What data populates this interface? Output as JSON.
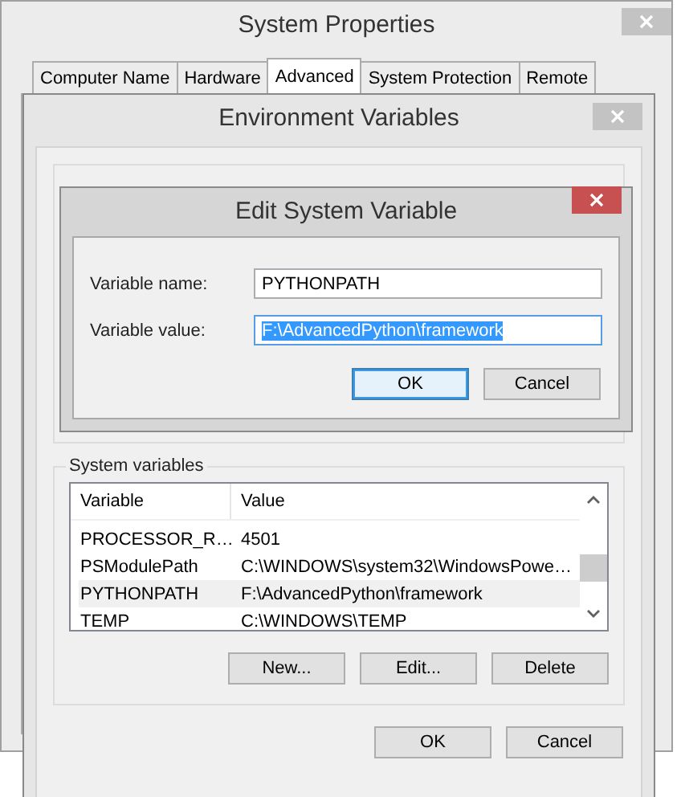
{
  "system_properties": {
    "title": "System Properties",
    "tabs": [
      {
        "label": "Computer Name",
        "selected": false
      },
      {
        "label": "Hardware",
        "selected": false
      },
      {
        "label": "Advanced",
        "selected": true
      },
      {
        "label": "System Protection",
        "selected": false
      },
      {
        "label": "Remote",
        "selected": false
      }
    ]
  },
  "environment_variables": {
    "title": "Environment Variables",
    "system_variables": {
      "label": "System variables",
      "columns": [
        "Variable",
        "Value"
      ],
      "rows": [
        {
          "variable": "PROCESSOR_R…",
          "value": "4501",
          "selected": false
        },
        {
          "variable": "PSModulePath",
          "value": "C:\\WINDOWS\\system32\\WindowsPowe…",
          "selected": false
        },
        {
          "variable": "PYTHONPATH",
          "value": "F:\\AdvancedPython\\framework",
          "selected": true
        },
        {
          "variable": "TEMP",
          "value": "C:\\WINDOWS\\TEMP",
          "selected": false
        }
      ],
      "buttons": [
        "New...",
        "Edit...",
        "Delete"
      ]
    },
    "buttons": [
      "OK",
      "Cancel"
    ]
  },
  "edit_dialog": {
    "title": "Edit System Variable",
    "fields": [
      {
        "label": "Variable name:",
        "value": "PYTHONPATH",
        "focused": false
      },
      {
        "label": "Variable value:",
        "value": "F:\\AdvancedPython\\framework",
        "focused": true
      }
    ],
    "buttons": [
      {
        "label": "OK",
        "default": true
      },
      {
        "label": "Cancel",
        "default": false
      }
    ]
  }
}
